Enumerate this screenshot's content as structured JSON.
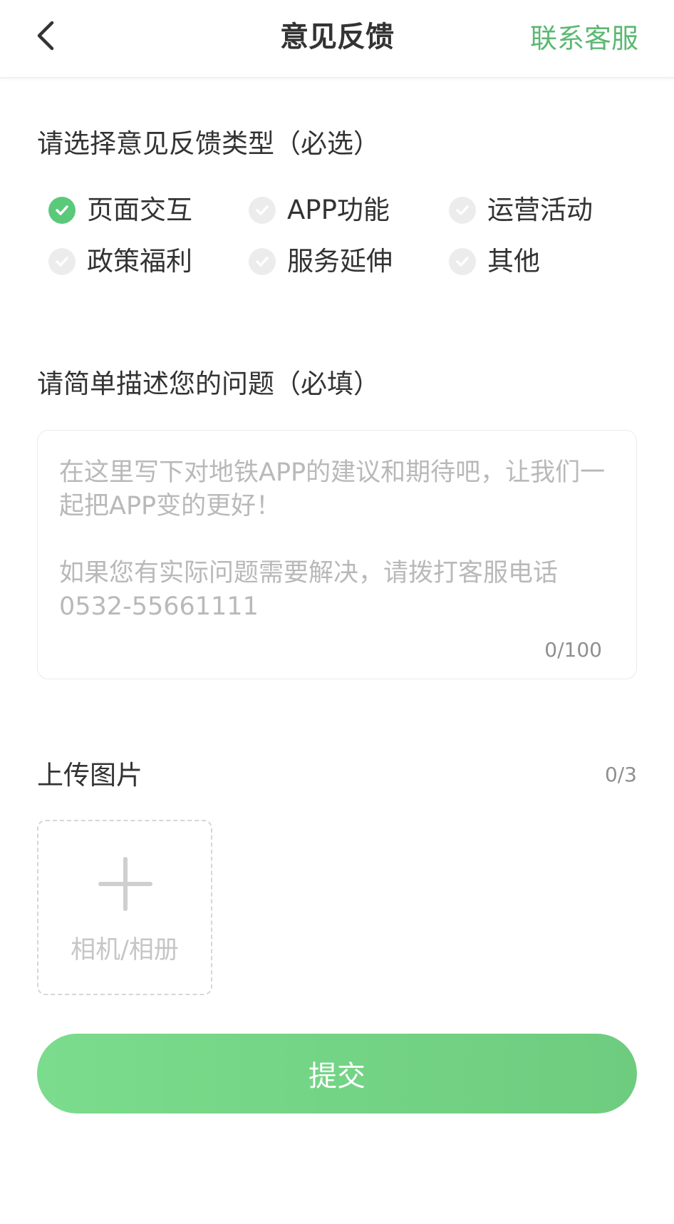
{
  "colors": {
    "accent": "#5cb873",
    "check_on": "#5bc97a",
    "check_off": "#ececec",
    "submit_start": "#7adc8c",
    "submit_end": "#6ecc7f"
  },
  "header": {
    "back_icon": "chevron-left-icon",
    "title": "意见反馈",
    "contact_label": "联系客服"
  },
  "feedback_type": {
    "title": "请选择意见反馈类型（必选）",
    "options": [
      {
        "label": "页面交互",
        "selected": true
      },
      {
        "label": "APP功能",
        "selected": false
      },
      {
        "label": "运营活动",
        "selected": false
      },
      {
        "label": "政策福利",
        "selected": false
      },
      {
        "label": "服务延伸",
        "selected": false
      },
      {
        "label": "其他",
        "selected": false
      }
    ]
  },
  "description": {
    "title": "请简单描述您的问题（必填）",
    "placeholder": "在这里写下对地铁APP的建议和期待吧，让我们一起把APP变的更好！\n\n如果您有实际问题需要解决，请拨打客服电话0532-55661111",
    "counter": "0/100"
  },
  "upload": {
    "title": "上传图片",
    "counter": "0/3",
    "add_icon": "plus-icon",
    "add_label": "相机/相册"
  },
  "submit": {
    "label": "提交"
  }
}
